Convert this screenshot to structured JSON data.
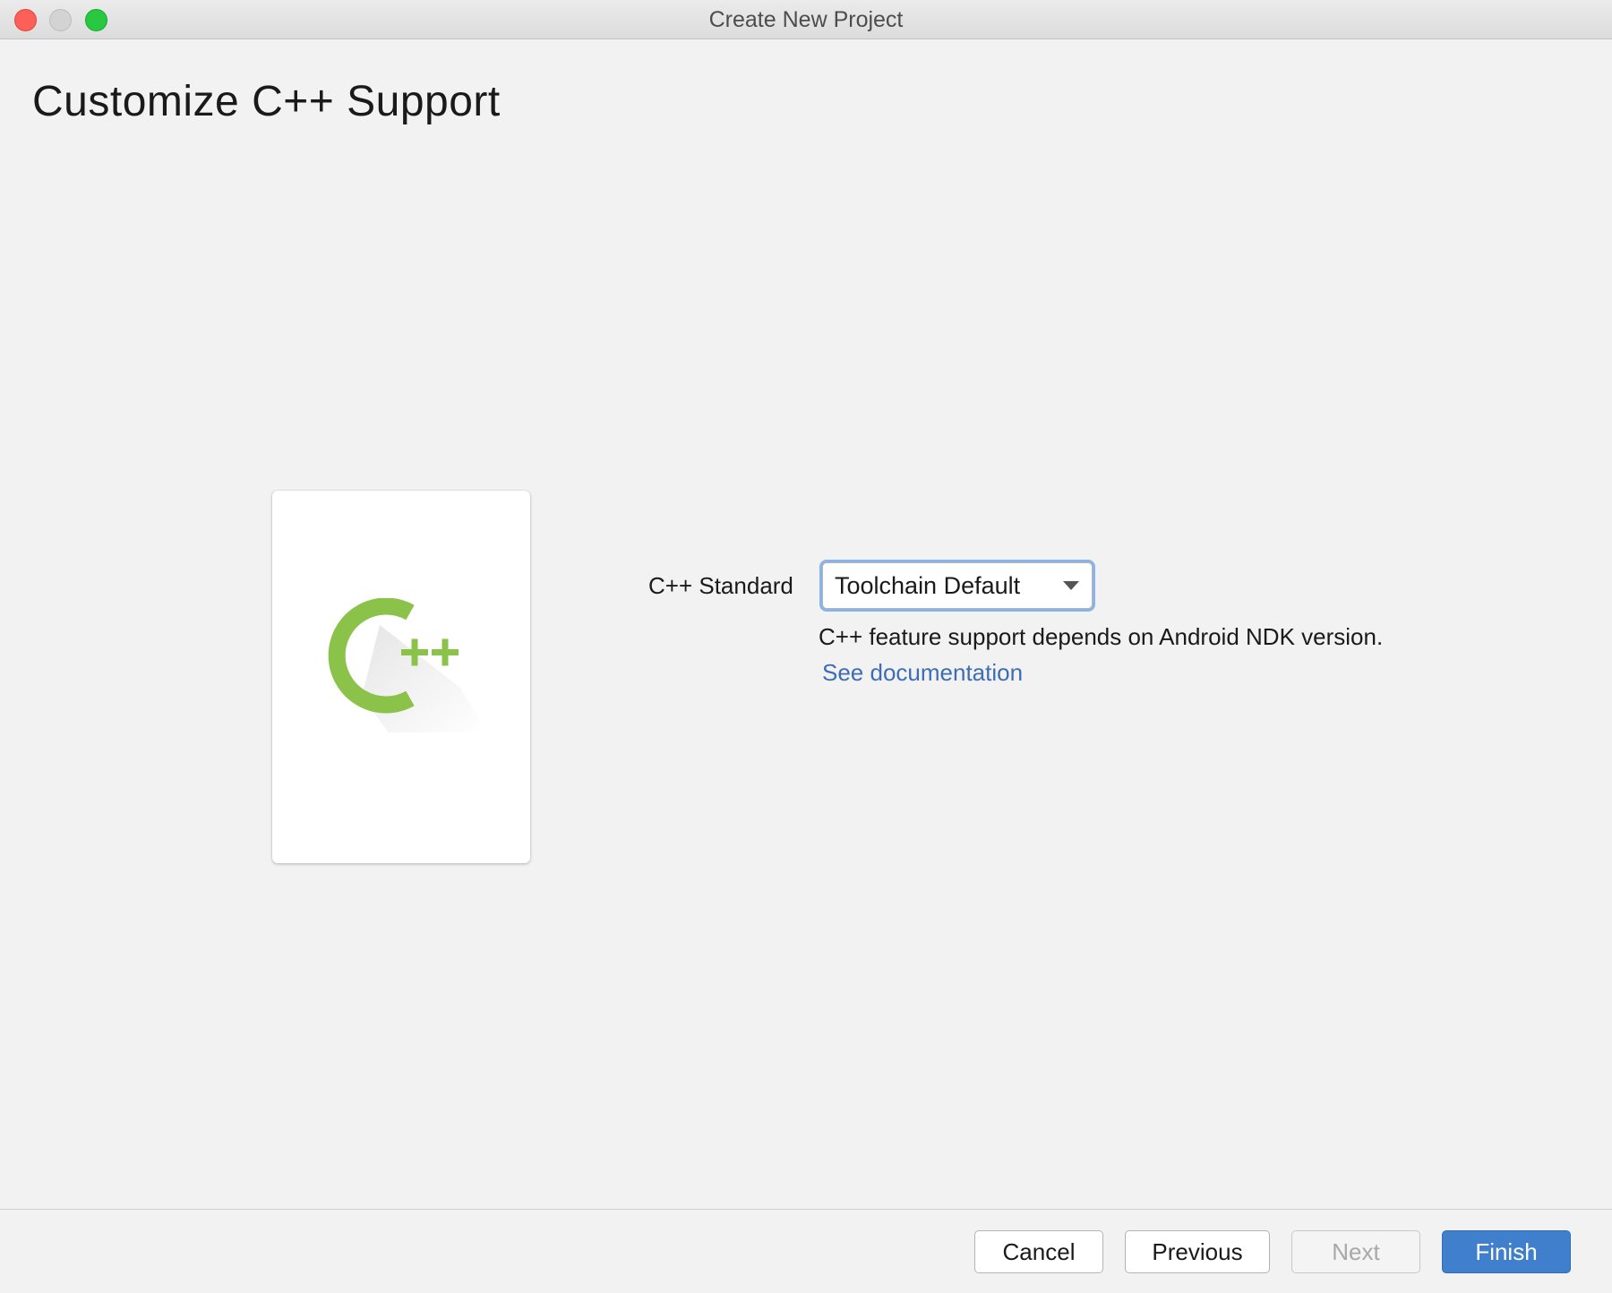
{
  "window": {
    "title": "Create New Project"
  },
  "page": {
    "title": "Customize C++ Support"
  },
  "preview": {
    "logo_icon": "cpp-logo-icon",
    "logo_color": "#8bc34a"
  },
  "form": {
    "cpp_standard_label": "C++ Standard",
    "cpp_standard_value": "Toolchain Default",
    "help_text": "C++ feature support depends on Android NDK version.",
    "doc_link": "See documentation"
  },
  "footer": {
    "cancel_label": "Cancel",
    "previous_label": "Previous",
    "next_label": "Next",
    "finish_label": "Finish"
  },
  "colors": {
    "accent": "#3f7fcc",
    "link": "#3d6db4",
    "focus_ring": "#8ab4e8"
  }
}
